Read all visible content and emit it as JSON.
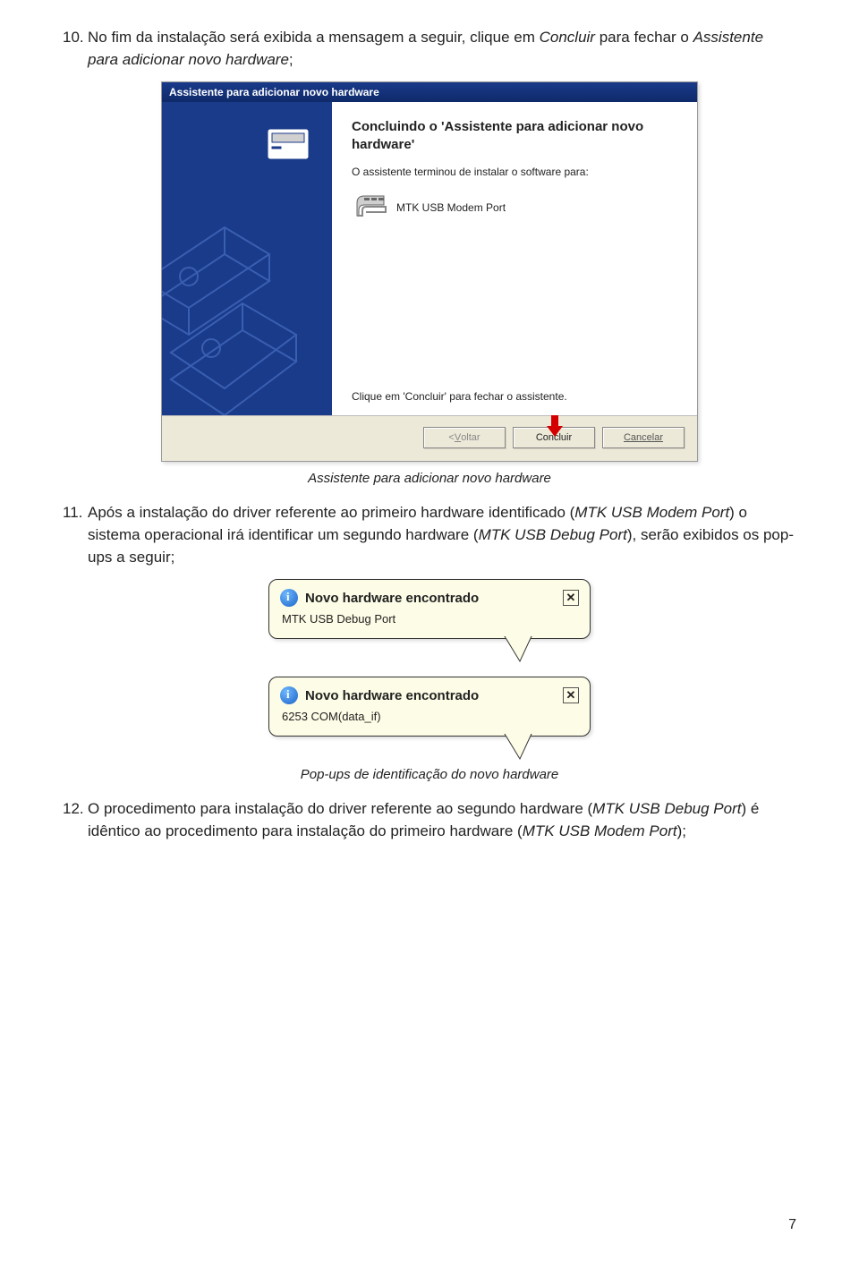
{
  "step10": {
    "num": "10.",
    "pre": "No fim da instalação será exibida a mensagem a seguir, clique em ",
    "action": "Concluir",
    "mid": " para fechar o ",
    "target": "Assistente para adicionar novo hardware",
    "post": ";"
  },
  "wizard": {
    "title": "Assistente para adicionar novo hardware",
    "heading": "Concluindo o 'Assistente para adicionar novo hardware'",
    "sub": "O assistente terminou de instalar o software para:",
    "device": "MTK USB Modem Port",
    "foot": "Clique em 'Concluir' para fechar o assistente.",
    "back_u": "V",
    "back_rest": "oltar",
    "back_pre": "< ",
    "finish": "Concluir",
    "cancel": "Cancelar"
  },
  "caption1": "Assistente para adicionar novo hardware",
  "step11": {
    "num": "11.",
    "pre": "Após a instalação do driver referente ao primeiro hardware identificado (",
    "hw1": "MTK USB Modem Port",
    "mid": ") o sistema operacional irá identificar um segundo hardware (",
    "hw2": "MTK USB Debug Port",
    "post": "), serão exibidos os pop-ups a seguir;"
  },
  "popup1": {
    "title": "Novo hardware encontrado",
    "sub": "MTK USB Debug Port"
  },
  "popup2": {
    "title": "Novo hardware encontrado",
    "sub": "6253  COM(data_if)"
  },
  "caption2": "Pop-ups de identificação do novo hardware",
  "step12": {
    "num": "12.",
    "pre": "O procedimento para instalação do driver referente ao segundo hardware (",
    "hw1": "MTK USB Debug Port",
    "mid": ") é idêntico ao procedimento para instalação do primeiro hardware (",
    "hw2": "MTK USB Modem Port",
    "post": ");"
  },
  "pagenum": "7"
}
